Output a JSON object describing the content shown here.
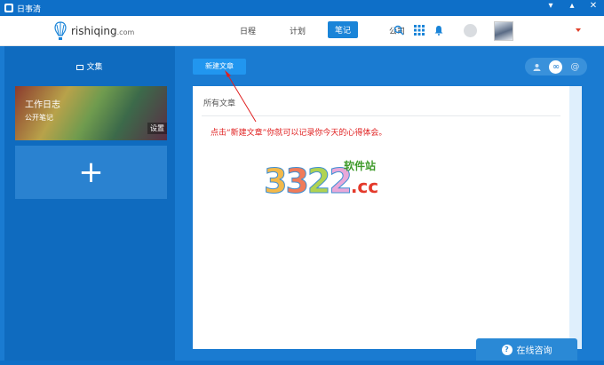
{
  "window": {
    "title": "日事清",
    "minimize": "▾",
    "restore": "▾",
    "close": "✕"
  },
  "nav": {
    "brand": "rishiqing",
    "brand_suffix": ".com",
    "links": [
      "日程",
      "计划",
      "笔记",
      "公司"
    ],
    "active": "笔记"
  },
  "sidebar": {
    "header": "文集",
    "card": {
      "title": "工作日志",
      "subtitle": "公开笔记",
      "settings": "设置"
    },
    "add_label": "+"
  },
  "main": {
    "new_button": "新建文章",
    "panel_title": "所有文章",
    "hint": "点击“新建文章”你就可以记录你今天的心得体会。"
  },
  "watermark": {
    "digits": [
      "3",
      "3",
      "2",
      "2"
    ],
    "suffix": ".cc",
    "text": "软件站"
  },
  "consult": {
    "label": "在线咨询",
    "icon": "?"
  },
  "colors": {
    "accent": "#1a84d8",
    "hint": "#e02020"
  }
}
